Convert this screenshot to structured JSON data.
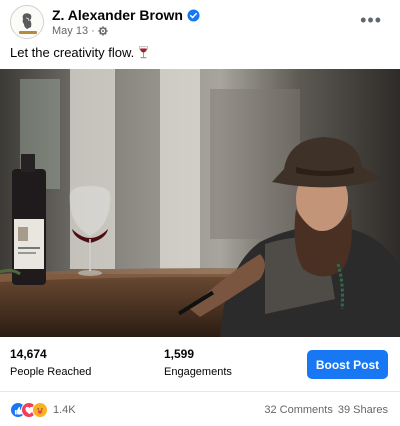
{
  "post": {
    "author": "Z. Alexander Brown",
    "date": "May 13",
    "separator": "·",
    "text": "Let the creativity flow.",
    "more_label": "•••"
  },
  "stats": {
    "reached_value": "14,674",
    "reached_label": "People Reached",
    "engagements_value": "1,599",
    "engagements_label": "Engagements",
    "boost_label": "Boost Post"
  },
  "reactions": {
    "count": "1.4K",
    "comments": "32 Comments",
    "shares": "39 Shares"
  },
  "colors": {
    "accent": "#1877f2",
    "love": "#f33e58",
    "haha": "#f7b125"
  }
}
